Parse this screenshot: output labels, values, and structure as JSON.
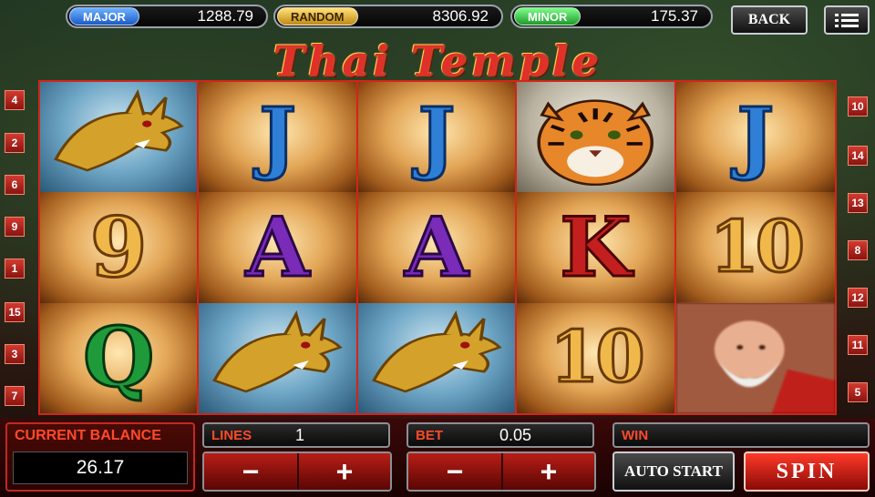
{
  "jackpots": [
    {
      "label": "MAJOR",
      "value": "1288.79",
      "color": "#1b5bc8"
    },
    {
      "label": "RANDOM",
      "value": "8306.92",
      "color": "#c08a14"
    },
    {
      "label": "MINOR",
      "value": "175.37",
      "color": "#1f9a2c"
    }
  ],
  "header": {
    "back_label": "BACK",
    "menu_icon": "menu-icon"
  },
  "title": "Thai Temple",
  "line_markers": {
    "left": [
      "4",
      "2",
      "6",
      "9",
      "1",
      "15",
      "3",
      "7"
    ],
    "right": [
      "10",
      "14",
      "13",
      "8",
      "12",
      "11",
      "5"
    ]
  },
  "reels": [
    [
      "dragon",
      "J",
      "J",
      "tiger",
      "J"
    ],
    [
      "9",
      "A",
      "A",
      "K",
      "10"
    ],
    [
      "Q",
      "dragon",
      "dragon",
      "10",
      "monk"
    ]
  ],
  "panel": {
    "balance_label": "CURRENT BALANCE",
    "balance_value": "26.17",
    "lines_label": "LINES",
    "lines_value": "1",
    "bet_label": "BET",
    "bet_value": "0.05",
    "win_label": "WIN",
    "win_value": "",
    "minus": "−",
    "plus": "+",
    "auto_start": "AUTO START",
    "spin": "SPIN"
  },
  "colors": {
    "accent_red": "#d42418",
    "panel_label": "#ff4a2a"
  }
}
